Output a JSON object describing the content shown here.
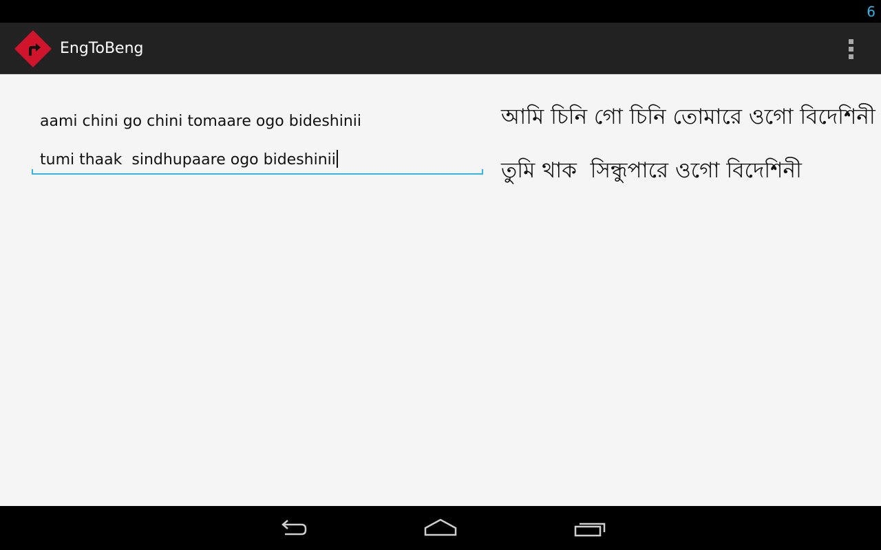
{
  "status_bar": {
    "clock": "6"
  },
  "action_bar": {
    "title": "EngToBeng",
    "icon": "app-logo-turn-right-sign",
    "overflow_icon": "overflow-menu-icon",
    "icon_color": "#d0142b"
  },
  "input": {
    "lines": [
      "aami chini go chini tomaare ogo bideshinii",
      "tumi thaak  sindhupaare ogo bideshinii"
    ],
    "accent_color": "#33b5e5"
  },
  "output": {
    "lines": [
      "আমি চিনি গো চিনি তোমারে ওগো বিদেশিনী",
      "তুমি থাক  সিন্ধুপারে ওগো বিদেশিনী"
    ]
  },
  "nav_bar": {
    "back_icon": "back-icon",
    "home_icon": "home-icon",
    "recents_icon": "recent-apps-icon"
  }
}
